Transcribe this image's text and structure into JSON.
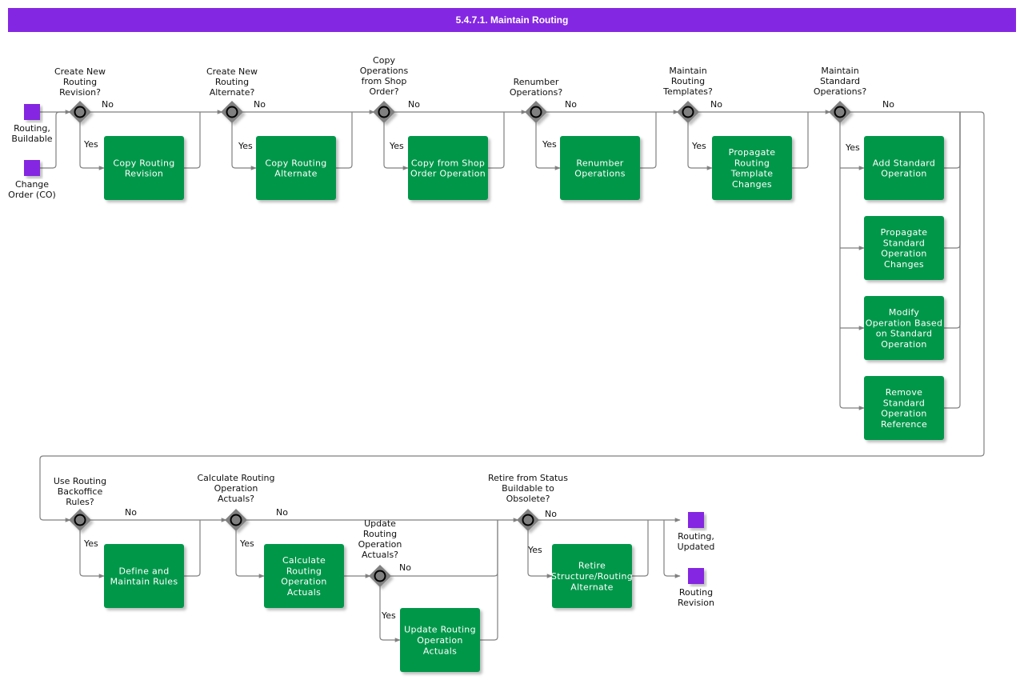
{
  "title": "5.4.7.1. Maintain Routing",
  "colors": {
    "title_bar": "#8427e2",
    "task": "#019748",
    "event": "#8427e2",
    "gateway": "#808080",
    "connector": "#808080"
  },
  "start_events": [
    {
      "id": "ev-routing-buildable",
      "label": "Routing,\nBuildable"
    },
    {
      "id": "ev-change-order",
      "label": "Change\nOrder (CO)"
    }
  ],
  "end_events": [
    {
      "id": "ev-routing-updated",
      "label": "Routing,\nUpdated"
    },
    {
      "id": "ev-routing-revision",
      "label": "Routing\nRevision"
    }
  ],
  "gateways": [
    {
      "id": "gw1",
      "question": "Create New\nRouting\nRevision?",
      "yes": "Yes",
      "no": "No"
    },
    {
      "id": "gw2",
      "question": "Create New\nRouting\nAlternate?",
      "yes": "Yes",
      "no": "No"
    },
    {
      "id": "gw3",
      "question": "Copy\nOperations\nfrom Shop\nOrder?",
      "yes": "Yes",
      "no": "No"
    },
    {
      "id": "gw4",
      "question": "Renumber\nOperations?",
      "yes": "Yes",
      "no": "No"
    },
    {
      "id": "gw5",
      "question": "Maintain\nRouting\nTemplates?",
      "yes": "Yes",
      "no": "No"
    },
    {
      "id": "gw6",
      "question": "Maintain\nStandard\nOperations?",
      "yes": "Yes",
      "no": "No"
    },
    {
      "id": "gw7",
      "question": "Use Routing\nBackoffice\nRules?",
      "yes": "Yes",
      "no": "No"
    },
    {
      "id": "gw8",
      "question": "Calculate Routing\nOperation\nActuals?",
      "yes": "Yes",
      "no": "No"
    },
    {
      "id": "gw9",
      "question": "Update\nRouting\nOperation\nActuals?",
      "yes": "Yes",
      "no": "No"
    },
    {
      "id": "gw10",
      "question": "Retire from Status\nBuildable to\nObsolete?",
      "yes": "Yes",
      "no": "No"
    }
  ],
  "tasks": [
    {
      "id": "t1",
      "label": "Copy Routing\nRevision"
    },
    {
      "id": "t2",
      "label": "Copy Routing\nAlternate"
    },
    {
      "id": "t3",
      "label": "Copy from Shop\nOrder Operation"
    },
    {
      "id": "t4",
      "label": "Renumber\nOperations"
    },
    {
      "id": "t5",
      "label": "Propagate\nRouting\nTemplate\nChanges"
    },
    {
      "id": "t6",
      "label": "Add Standard\nOperation"
    },
    {
      "id": "t7",
      "label": "Propagate\nStandard\nOperation\nChanges"
    },
    {
      "id": "t8",
      "label": "Modify\nOperation Based\non Standard\nOperation"
    },
    {
      "id": "t9",
      "label": "Remove\nStandard\nOperation\nReference"
    },
    {
      "id": "t10",
      "label": "Define and\nMaintain Rules"
    },
    {
      "id": "t11",
      "label": "Calculate\nRouting\nOperation\nActuals"
    },
    {
      "id": "t12",
      "label": "Update Routing\nOperation\nActuals"
    },
    {
      "id": "t13",
      "label": "Retire\nStructure/Routing\nAlternate"
    }
  ]
}
